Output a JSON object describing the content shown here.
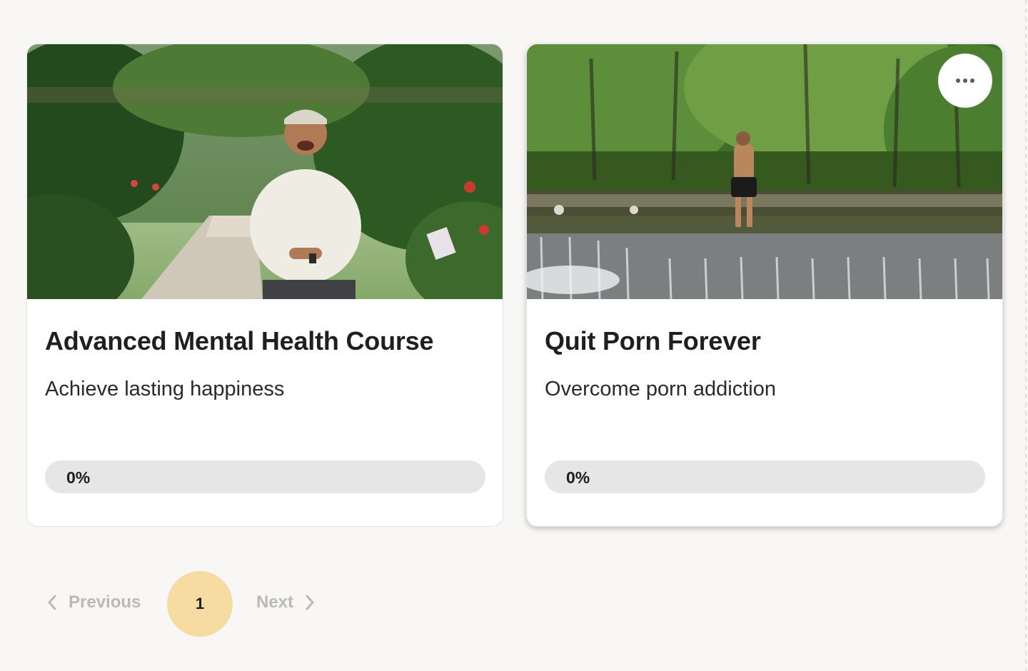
{
  "courses": [
    {
      "title": "Advanced Mental Health Course",
      "description": "Achieve lasting happiness",
      "progress_label": "0%",
      "progress": 0
    },
    {
      "title": "Quit Porn Forever",
      "description": "Overcome porn addiction",
      "progress_label": "0%",
      "progress": 0,
      "menu_icon": "more-horizontal-icon"
    }
  ],
  "pagination": {
    "previous_label": "Previous",
    "current_page": "1",
    "next_label": "Next"
  },
  "colors": {
    "background": "#f8f7f5",
    "card": "#ffffff",
    "progress_track": "#e6e6e6",
    "page_active": "#f6dca3",
    "pager_disabled_text": "#b9b9b9"
  }
}
